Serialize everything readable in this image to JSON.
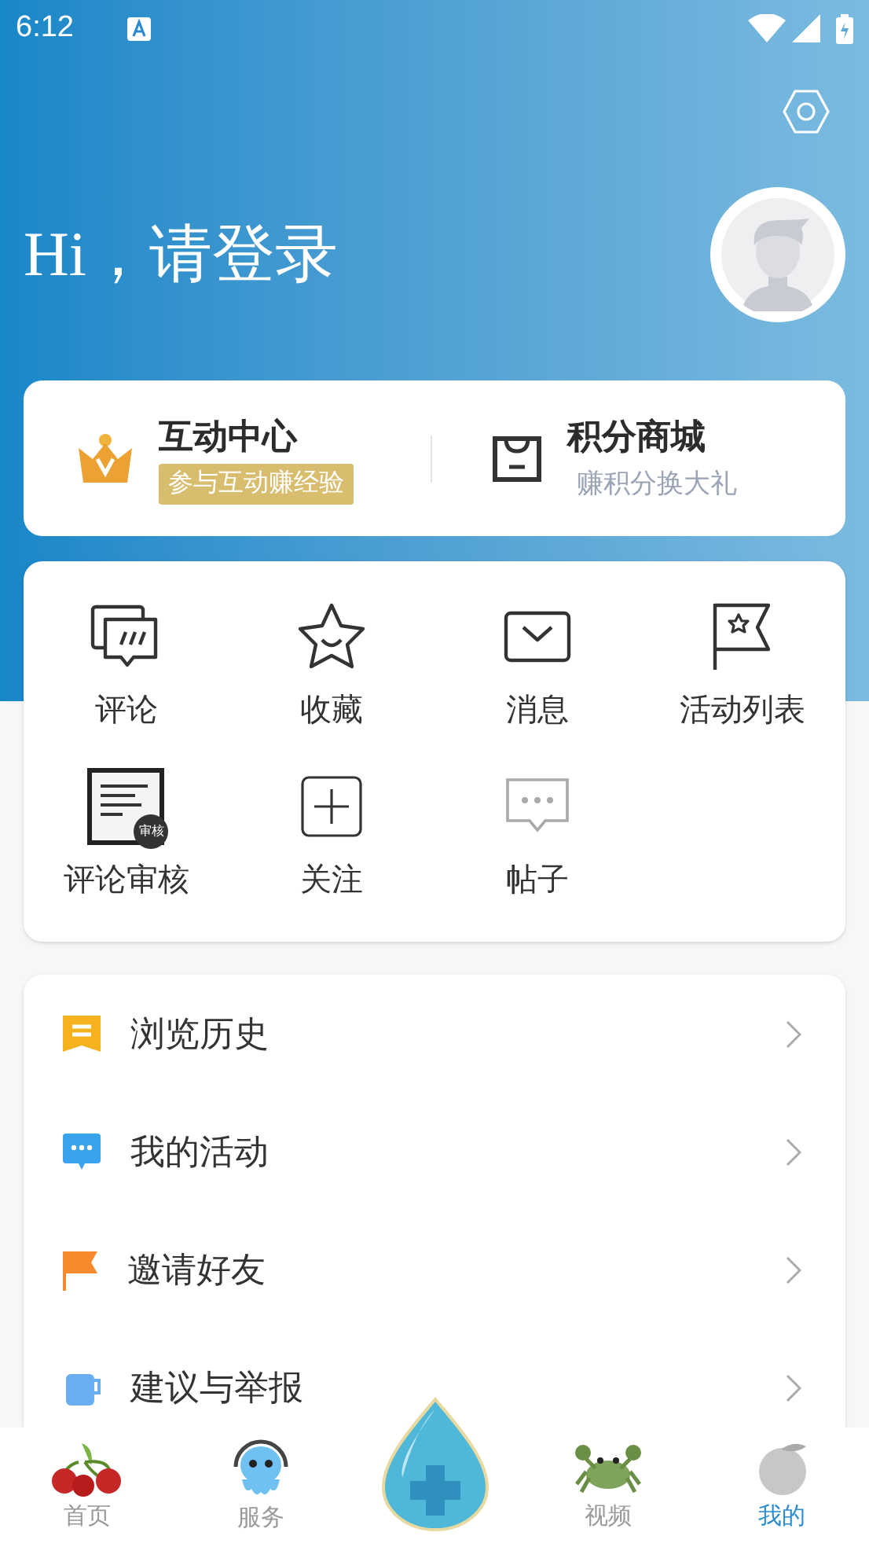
{
  "status_bar": {
    "time": "6:12"
  },
  "greeting": "Hi，请登录",
  "cards": [
    {
      "kind": "badge",
      "title": "互动中心",
      "subtitle": "参与互动赚经验"
    },
    {
      "kind": "plain",
      "title": "积分商城",
      "subtitle": "赚积分换大礼"
    }
  ],
  "grid": [
    {
      "label": "评论"
    },
    {
      "label": "收藏"
    },
    {
      "label": "消息"
    },
    {
      "label": "活动列表"
    },
    {
      "label": "评论审核",
      "badge": "审核"
    },
    {
      "label": "关注"
    },
    {
      "label": "帖子"
    }
  ],
  "menu": [
    {
      "label": "浏览历史"
    },
    {
      "label": "我的活动"
    },
    {
      "label": "邀请好友"
    },
    {
      "label": "建议与举报"
    }
  ],
  "tab_bar": [
    {
      "label": "首页",
      "selected": false
    },
    {
      "label": "服务",
      "selected": false
    },
    {
      "label": "视频",
      "selected": false
    },
    {
      "label": "我的",
      "selected": true
    }
  ]
}
